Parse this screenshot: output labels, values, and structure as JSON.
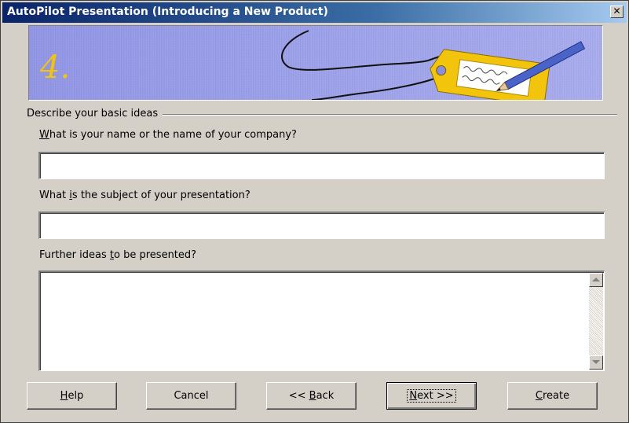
{
  "window": {
    "title": "AutoPilot Presentation (Introducing a New Product)",
    "close_glyph": "✕"
  },
  "banner": {
    "step_number": "4.",
    "background_color": "#8a8ee0",
    "tag_color": "#f2c40c",
    "pencil_color": "#4a63c8"
  },
  "group": {
    "title": "Describe your basic ideas"
  },
  "fields": {
    "company": {
      "label_pre": "",
      "label_key": "W",
      "label_post": "hat is your name or the name of your company?",
      "value": ""
    },
    "subject": {
      "label_pre": "What ",
      "label_key": "i",
      "label_post": "s the subject of your presentation?",
      "value": ""
    },
    "ideas": {
      "label_pre": "Further ideas ",
      "label_key": "t",
      "label_post": "o be presented?",
      "value": ""
    }
  },
  "buttons": {
    "help": {
      "key": "H",
      "rest": "elp"
    },
    "cancel": {
      "label": "Cancel"
    },
    "back": {
      "pre": "<< ",
      "key": "B",
      "rest": "ack"
    },
    "next": {
      "key": "N",
      "rest": "ext >>"
    },
    "create": {
      "key": "C",
      "rest": "reate"
    }
  }
}
